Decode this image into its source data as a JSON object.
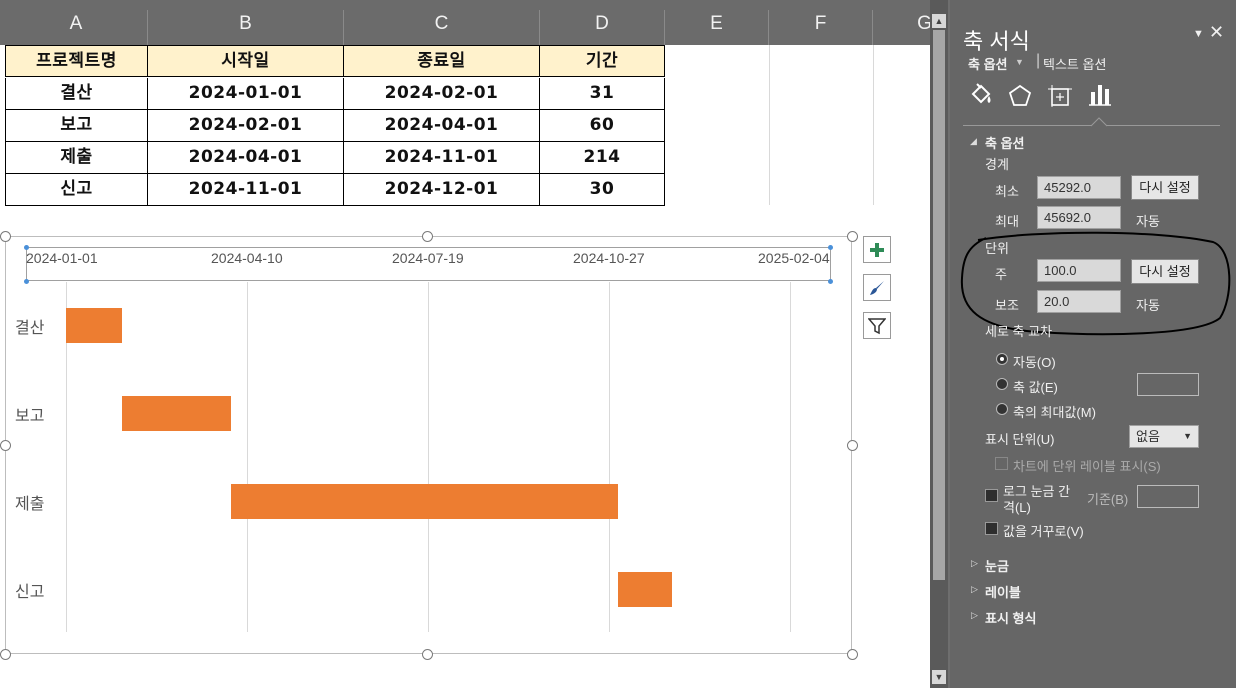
{
  "sheet": {
    "columns": [
      "A",
      "B",
      "C",
      "D",
      "E",
      "F",
      "G"
    ],
    "header": [
      "프로젝트명",
      "시작일",
      "종료일",
      "기간"
    ],
    "rows": [
      [
        "결산",
        "2024-01-01",
        "2024-02-01",
        "31"
      ],
      [
        "보고",
        "2024-02-01",
        "2024-04-01",
        "60"
      ],
      [
        "제출",
        "2024-04-01",
        "2024-11-01",
        "214"
      ],
      [
        "신고",
        "2024-11-01",
        "2024-12-01",
        "30"
      ]
    ],
    "header_fill": "#fff2cc"
  },
  "chart_data": {
    "type": "bar",
    "orientation": "horizontal-gantt",
    "x_ticks": [
      "2024-01-01",
      "2024-04-10",
      "2024-07-19",
      "2024-10-27",
      "2025-02-04"
    ],
    "xlim": [
      "2024-01-01",
      "2025-02-04"
    ],
    "categories": [
      "결산",
      "보고",
      "제출",
      "신고"
    ],
    "starts": [
      "2024-01-01",
      "2024-02-01",
      "2024-04-01",
      "2024-11-01"
    ],
    "durations": [
      31,
      60,
      214,
      30
    ],
    "bar_color": "#ed7d31",
    "grid": true
  },
  "chart_buttons": [
    "plus-icon",
    "brush-icon",
    "filter-icon"
  ],
  "pane": {
    "title": "축 서식",
    "tab_axis": "축 옵션",
    "tab_text": "텍스트 옵션",
    "section_axis": "축 옵션",
    "bounds_label": "경계",
    "min_label": "최소",
    "min_value": "45292.0",
    "min_reset": "다시 설정",
    "max_label": "최대",
    "max_value": "45692.0",
    "max_auto": "자동",
    "units_label": "단위",
    "major_label": "주",
    "major_value": "100.0",
    "major_reset": "다시 설정",
    "minor_label": "보조",
    "minor_value": "20.0",
    "minor_auto": "자동",
    "cross_label": "세로 축 교차",
    "radio_auto": "자동(O)",
    "radio_value": "축 값(E)",
    "radio_max": "축의 최대값(M)",
    "display_units_label": "표시 단위(U)",
    "display_units_value": "없음",
    "show_units_label": "차트에 단위 레이블 표시(S)",
    "log_label": "로그 눈금 간",
    "log_label2": "격(L)",
    "base_label": "기준(B)",
    "reverse_label": "값을 거꾸로(V)",
    "sec_ticks": "눈금",
    "sec_labels": "레이블",
    "sec_number": "표시 형식"
  }
}
